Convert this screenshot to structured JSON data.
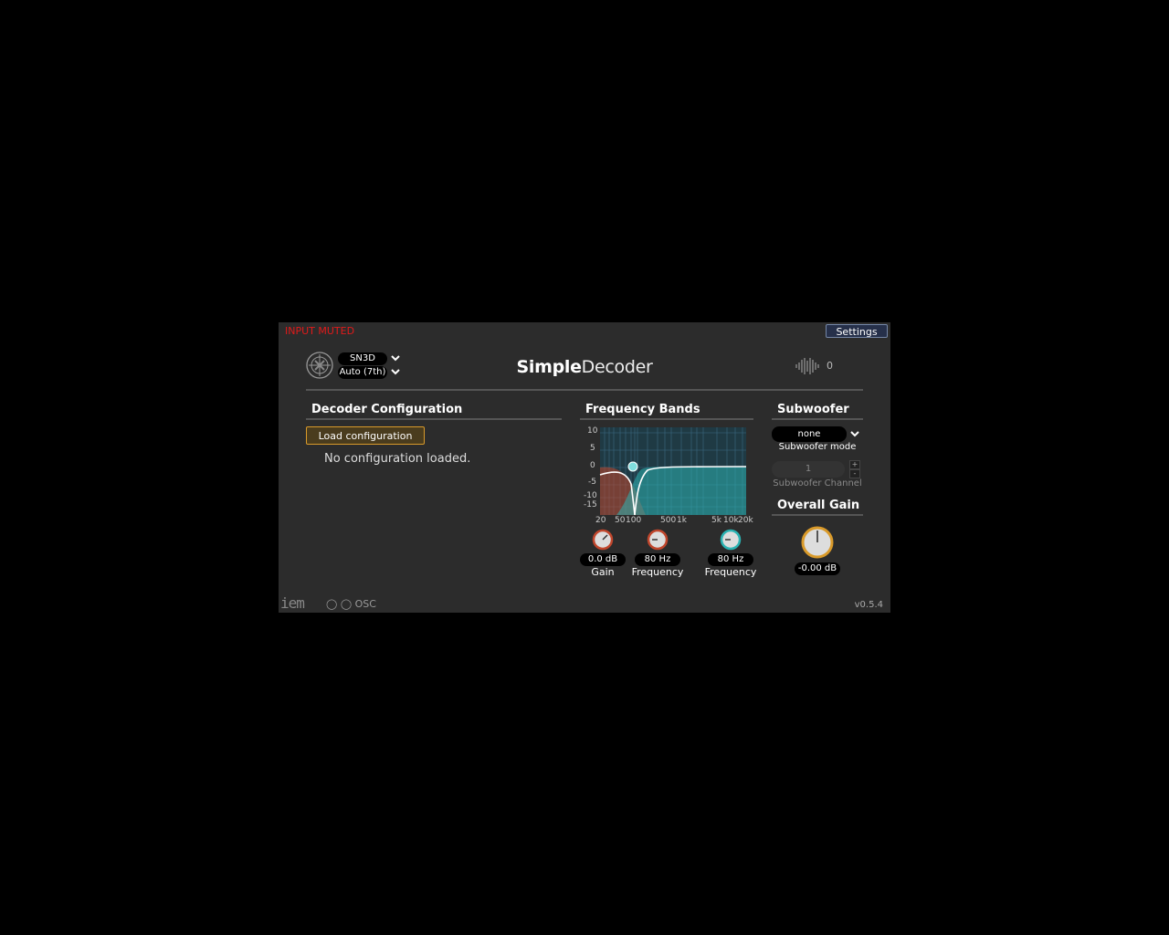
{
  "header": {
    "input_muted": "INPUT MUTED",
    "settings_label": "Settings",
    "normalization": "SN3D",
    "order": "Auto (7th)",
    "title_bold": "Simple",
    "title_thin": "Decoder",
    "output_channels": "0"
  },
  "decoder": {
    "title": "Decoder Configuration",
    "load_label": "Load configuration",
    "status": "No configuration loaded."
  },
  "bands": {
    "title": "Frequency Bands",
    "y_ticks": [
      "10",
      "5",
      "0",
      "-5",
      "-10",
      "-15"
    ],
    "x_ticks": [
      "20",
      "50",
      "100",
      "500",
      "1k",
      "5k",
      "10k",
      "20k"
    ],
    "knobs": [
      {
        "value": "0.0 dB",
        "label": "Gain"
      },
      {
        "value": "80 Hz",
        "label": "Frequency"
      },
      {
        "value": "80 Hz",
        "label": "Frequency"
      }
    ]
  },
  "subwoofer": {
    "title": "Subwoofer",
    "mode_value": "none",
    "mode_label": "Subwoofer mode",
    "channel_value": "1",
    "channel_label": "Subwoofer Channel"
  },
  "gain": {
    "title": "Overall Gain",
    "value": "-0.00 dB"
  },
  "footer": {
    "logo": "iem",
    "osc_label": "OSC",
    "version": "v0.5.4"
  },
  "colors": {
    "lowpass": "#c0462c",
    "highpass": "#2bb3b3",
    "muted": "#e01a1a",
    "accent": "#d99a2a"
  }
}
